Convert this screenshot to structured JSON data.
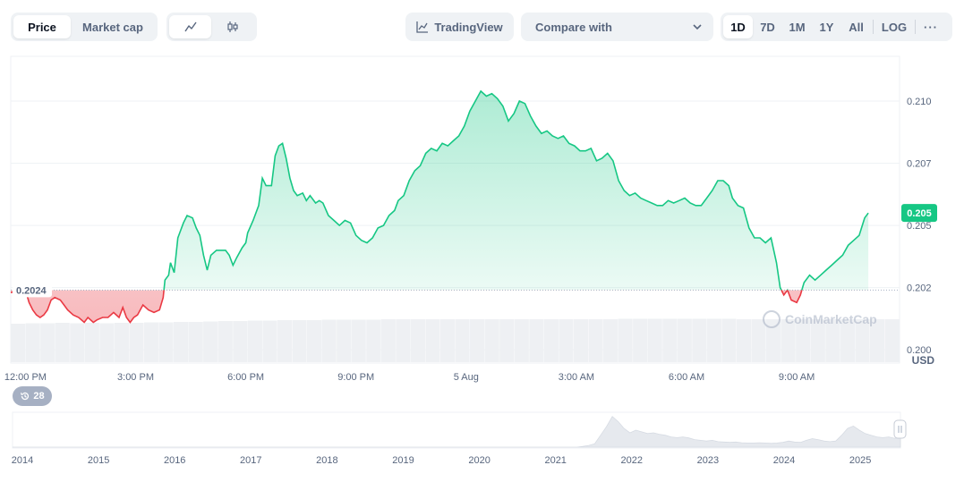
{
  "metric_tabs": [
    {
      "label": "Price",
      "active": true
    },
    {
      "label": "Market cap",
      "active": false
    }
  ],
  "chart_type_icons": [
    "line-chart-icon",
    "candlestick-icon"
  ],
  "tradingview_label": "TradingView",
  "compare_label": "Compare with",
  "ranges": [
    "1D",
    "7D",
    "1M",
    "1Y",
    "All"
  ],
  "active_range": "1D",
  "log_label": "LOG",
  "more_label": "···",
  "reference_price_label": "0.2024",
  "currency_label": "USD",
  "history_badge_count": "28",
  "watermark": "CoinMarketCap",
  "colors": {
    "up": "#16c784",
    "down": "#ea3943",
    "axis_text": "#58667e",
    "grid": "#eff2f5"
  },
  "chart_data": {
    "type": "area",
    "ylim": [
      0.1995,
      0.2118
    ],
    "y_ticks": [
      "0.210",
      "0.207",
      "0.205",
      "0.202",
      "0.200"
    ],
    "y_tick_values": [
      0.21,
      0.2075,
      0.205,
      0.2025,
      0.2
    ],
    "x_ticks": [
      "12:00 PM",
      "3:00 PM",
      "6:00 PM",
      "9:00 PM",
      "5 Aug",
      "3:00 AM",
      "6:00 AM",
      "9:00 AM"
    ],
    "x_tick_hours": [
      0,
      3,
      6,
      9,
      12,
      15,
      18,
      21
    ],
    "x_range_hours": [
      -0.4,
      23.8
    ],
    "reference_value": 0.2024,
    "current_value": 0.2055,
    "current_label": "0.205",
    "series": [
      {
        "points": [
          [
            -0.4,
            0.2023
          ],
          [
            0.0,
            0.2024
          ],
          [
            0.1,
            0.2019
          ],
          [
            0.2,
            0.2016
          ],
          [
            0.3,
            0.2014
          ],
          [
            0.4,
            0.2013
          ],
          [
            0.5,
            0.2014
          ],
          [
            0.6,
            0.2016
          ],
          [
            0.7,
            0.202
          ],
          [
            0.8,
            0.2021
          ],
          [
            0.95,
            0.202
          ],
          [
            1.05,
            0.2018
          ],
          [
            1.15,
            0.2016
          ],
          [
            1.3,
            0.2014
          ],
          [
            1.45,
            0.2013
          ],
          [
            1.6,
            0.2011
          ],
          [
            1.7,
            0.2013
          ],
          [
            1.85,
            0.2011
          ],
          [
            1.95,
            0.2012
          ],
          [
            2.1,
            0.2013
          ],
          [
            2.25,
            0.2013
          ],
          [
            2.4,
            0.2015
          ],
          [
            2.55,
            0.2013
          ],
          [
            2.65,
            0.2017
          ],
          [
            2.75,
            0.2013
          ],
          [
            2.85,
            0.2011
          ],
          [
            2.95,
            0.2013
          ],
          [
            3.05,
            0.2014
          ],
          [
            3.2,
            0.2018
          ],
          [
            3.35,
            0.2016
          ],
          [
            3.5,
            0.2015
          ],
          [
            3.65,
            0.2016
          ],
          [
            3.75,
            0.2021
          ],
          [
            3.8,
            0.2028
          ],
          [
            3.9,
            0.203
          ],
          [
            3.95,
            0.2035
          ],
          [
            4.05,
            0.2031
          ],
          [
            4.15,
            0.2045
          ],
          [
            4.3,
            0.2051
          ],
          [
            4.4,
            0.2054
          ],
          [
            4.55,
            0.2053
          ],
          [
            4.65,
            0.2049
          ],
          [
            4.75,
            0.2046
          ],
          [
            4.85,
            0.2038
          ],
          [
            4.95,
            0.2032
          ],
          [
            5.05,
            0.2038
          ],
          [
            5.2,
            0.204
          ],
          [
            5.35,
            0.204
          ],
          [
            5.45,
            0.204
          ],
          [
            5.55,
            0.2038
          ],
          [
            5.65,
            0.2034
          ],
          [
            5.75,
            0.2037
          ],
          [
            5.9,
            0.2041
          ],
          [
            6.0,
            0.2043
          ],
          [
            6.05,
            0.2047
          ],
          [
            6.2,
            0.2052
          ],
          [
            6.35,
            0.2058
          ],
          [
            6.45,
            0.2069
          ],
          [
            6.55,
            0.2066
          ],
          [
            6.7,
            0.2066
          ],
          [
            6.8,
            0.2078
          ],
          [
            6.9,
            0.2082
          ],
          [
            7.0,
            0.2083
          ],
          [
            7.1,
            0.2077
          ],
          [
            7.2,
            0.2069
          ],
          [
            7.3,
            0.2064
          ],
          [
            7.4,
            0.2062
          ],
          [
            7.55,
            0.2063
          ],
          [
            7.65,
            0.206
          ],
          [
            7.75,
            0.2062
          ],
          [
            7.9,
            0.2059
          ],
          [
            8.0,
            0.206
          ],
          [
            8.1,
            0.2059
          ],
          [
            8.25,
            0.2054
          ],
          [
            8.4,
            0.2052
          ],
          [
            8.55,
            0.205
          ],
          [
            8.7,
            0.2052
          ],
          [
            8.85,
            0.2051
          ],
          [
            9.0,
            0.2046
          ],
          [
            9.15,
            0.2044
          ],
          [
            9.3,
            0.2043
          ],
          [
            9.45,
            0.2045
          ],
          [
            9.6,
            0.2049
          ],
          [
            9.75,
            0.205
          ],
          [
            9.9,
            0.2054
          ],
          [
            10.05,
            0.2056
          ],
          [
            10.15,
            0.206
          ],
          [
            10.3,
            0.2062
          ],
          [
            10.45,
            0.2068
          ],
          [
            10.6,
            0.2072
          ],
          [
            10.75,
            0.2074
          ],
          [
            10.9,
            0.2079
          ],
          [
            11.05,
            0.2081
          ],
          [
            11.2,
            0.208
          ],
          [
            11.35,
            0.2083
          ],
          [
            11.5,
            0.2082
          ],
          [
            11.65,
            0.2084
          ],
          [
            11.8,
            0.2086
          ],
          [
            11.95,
            0.209
          ],
          [
            12.1,
            0.2096
          ],
          [
            12.25,
            0.21
          ],
          [
            12.4,
            0.2104
          ],
          [
            12.55,
            0.2102
          ],
          [
            12.7,
            0.2103
          ],
          [
            12.85,
            0.2101
          ],
          [
            13.0,
            0.2098
          ],
          [
            13.15,
            0.2092
          ],
          [
            13.3,
            0.2095
          ],
          [
            13.45,
            0.21
          ],
          [
            13.6,
            0.2099
          ],
          [
            13.75,
            0.2094
          ],
          [
            13.9,
            0.209
          ],
          [
            14.05,
            0.2087
          ],
          [
            14.2,
            0.2088
          ],
          [
            14.35,
            0.2086
          ],
          [
            14.5,
            0.2085
          ],
          [
            14.65,
            0.2086
          ],
          [
            14.8,
            0.2083
          ],
          [
            14.95,
            0.2082
          ],
          [
            15.1,
            0.208
          ],
          [
            15.25,
            0.208
          ],
          [
            15.4,
            0.2081
          ],
          [
            15.55,
            0.2076
          ],
          [
            15.7,
            0.2077
          ],
          [
            15.85,
            0.2079
          ],
          [
            16.0,
            0.2076
          ],
          [
            16.15,
            0.2068
          ],
          [
            16.3,
            0.2064
          ],
          [
            16.45,
            0.2062
          ],
          [
            16.6,
            0.2063
          ],
          [
            16.75,
            0.2061
          ],
          [
            16.9,
            0.206
          ],
          [
            17.05,
            0.2059
          ],
          [
            17.2,
            0.2058
          ],
          [
            17.35,
            0.2058
          ],
          [
            17.5,
            0.206
          ],
          [
            17.65,
            0.2059
          ],
          [
            17.8,
            0.206
          ],
          [
            17.95,
            0.2061
          ],
          [
            18.1,
            0.2059
          ],
          [
            18.25,
            0.2058
          ],
          [
            18.4,
            0.2058
          ],
          [
            18.55,
            0.2061
          ],
          [
            18.7,
            0.2064
          ],
          [
            18.85,
            0.2068
          ],
          [
            19.0,
            0.2068
          ],
          [
            19.15,
            0.2066
          ],
          [
            19.25,
            0.2061
          ],
          [
            19.4,
            0.2058
          ],
          [
            19.55,
            0.2057
          ],
          [
            19.7,
            0.2049
          ],
          [
            19.85,
            0.2045
          ],
          [
            20.0,
            0.2045
          ],
          [
            20.15,
            0.2043
          ],
          [
            20.3,
            0.2045
          ],
          [
            20.45,
            0.2035
          ],
          [
            20.55,
            0.2025
          ],
          [
            20.65,
            0.2022
          ],
          [
            20.75,
            0.2024
          ],
          [
            20.85,
            0.202
          ],
          [
            21.0,
            0.2019
          ],
          [
            21.1,
            0.2022
          ],
          [
            21.2,
            0.2027
          ],
          [
            21.35,
            0.203
          ],
          [
            21.5,
            0.2028
          ],
          [
            21.65,
            0.203
          ],
          [
            21.8,
            0.2032
          ],
          [
            21.95,
            0.2034
          ],
          [
            22.1,
            0.2036
          ],
          [
            22.25,
            0.2038
          ],
          [
            22.4,
            0.2042
          ],
          [
            22.55,
            0.2044
          ],
          [
            22.7,
            0.2046
          ],
          [
            22.85,
            0.2053
          ],
          [
            22.95,
            0.2055
          ]
        ]
      }
    ],
    "volume": [
      0.86,
      0.87,
      0.87,
      0.88,
      0.87,
      0.88,
      0.87,
      0.88,
      0.88,
      0.89,
      0.89,
      0.9,
      0.9,
      0.91,
      0.92,
      0.92,
      0.93,
      0.93,
      0.94,
      0.94,
      0.94,
      0.95,
      0.95,
      0.95,
      0.95,
      0.96,
      0.96,
      0.96,
      0.96,
      0.96,
      0.96,
      0.96,
      0.96,
      0.96,
      0.96,
      0.96,
      0.96,
      0.96,
      0.96,
      0.96,
      0.96,
      0.97,
      0.97,
      0.97,
      0.97,
      0.97,
      0.97,
      0.97,
      0.97,
      0.96,
      0.96,
      0.96,
      0.96,
      0.96,
      0.96,
      0.96,
      0.96,
      0.96,
      0.96,
      0.96
    ],
    "history": {
      "years": [
        "2014",
        "2015",
        "2016",
        "2017",
        "2018",
        "2019",
        "2020",
        "2021",
        "2022",
        "2023",
        "2024",
        "2025"
      ],
      "values": [
        0,
        0,
        0,
        0,
        0,
        0,
        0,
        0,
        0,
        0,
        0,
        0,
        0,
        0,
        0,
        0,
        0,
        0,
        0,
        0,
        0,
        0,
        0,
        0,
        0,
        0,
        0,
        0,
        0,
        0,
        0,
        0,
        0,
        0,
        0,
        0,
        0,
        0,
        0,
        0,
        0,
        0,
        0,
        0,
        0,
        0,
        0,
        0,
        0,
        0,
        0,
        0,
        0,
        0,
        0,
        0,
        0,
        0,
        0,
        0,
        0,
        0,
        0,
        0,
        0,
        0,
        0,
        0,
        0,
        0,
        0,
        0,
        0,
        0,
        0,
        0,
        0,
        0,
        0,
        0,
        0,
        0,
        0,
        0,
        0,
        0,
        0,
        0,
        0,
        0,
        0,
        0,
        0,
        0,
        0,
        0,
        0,
        0.02,
        0.05,
        0.1,
        0.35,
        0.6,
        0.9,
        0.75,
        0.55,
        0.42,
        0.5,
        0.45,
        0.4,
        0.42,
        0.38,
        0.35,
        0.3,
        0.28,
        0.3,
        0.27,
        0.22,
        0.2,
        0.18,
        0.2,
        0.16,
        0.15,
        0.14,
        0.15,
        0.13,
        0.12,
        0.12,
        0.13,
        0.12,
        0.11,
        0.12,
        0.14,
        0.18,
        0.15,
        0.14,
        0.2,
        0.25,
        0.22,
        0.18,
        0.16,
        0.18,
        0.35,
        0.55,
        0.62,
        0.5,
        0.4,
        0.35,
        0.3,
        0.28,
        0.3,
        0.26,
        0.28
      ]
    }
  }
}
